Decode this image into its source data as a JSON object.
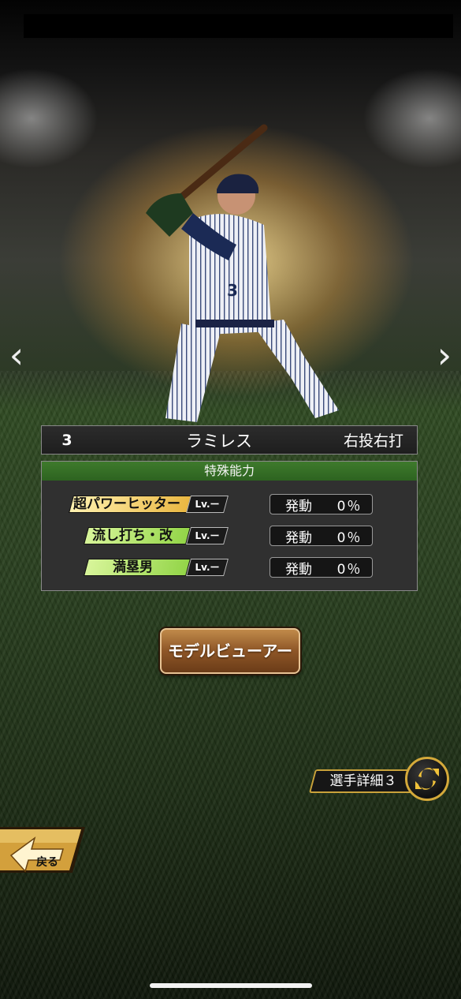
{
  "player": {
    "number": "3",
    "name": "ラミレス",
    "handedness": "右投右打"
  },
  "abilities": {
    "header": "特殊能力",
    "items": [
      {
        "prefix": "超",
        "name": "超パワーヒッター",
        "level": "Lv.ー",
        "activation_label": "発動",
        "activation_rate": "0％",
        "tag_color": "#f0c75a"
      },
      {
        "name": "流し打ち・改",
        "level": "Lv.ー",
        "activation_label": "発動",
        "activation_rate": "0％",
        "tag_color": "#a7e05a"
      },
      {
        "name": "満塁男",
        "level": "Lv.ー",
        "activation_label": "発動",
        "activation_rate": "0％",
        "tag_color": "#a7e05a"
      }
    ]
  },
  "buttons": {
    "model_viewer": "モデルビューアー",
    "player_detail": "選手詳細３",
    "back": "戻る"
  },
  "navigation": {
    "prev_icon": "chevron-left-icon",
    "next_icon": "chevron-right-icon"
  }
}
